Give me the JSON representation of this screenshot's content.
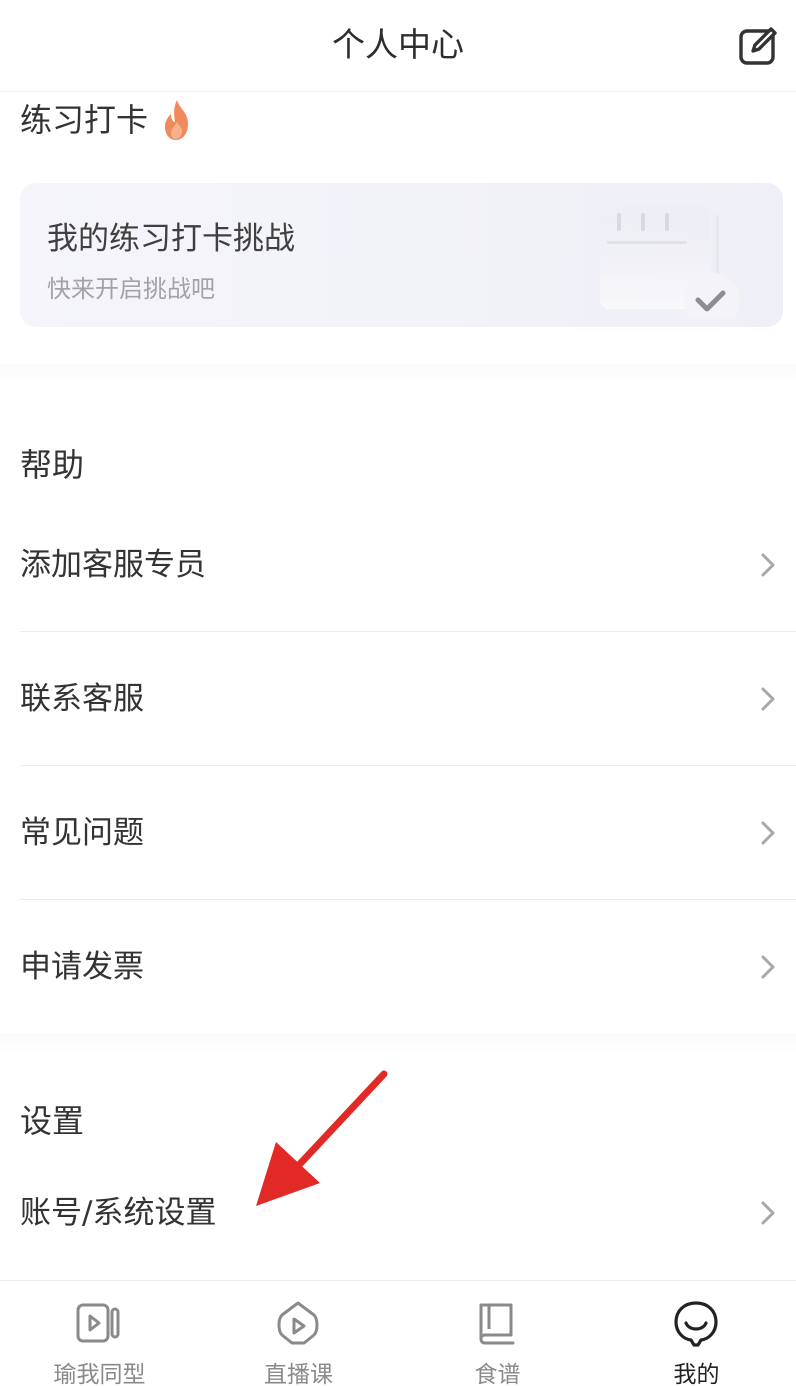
{
  "header": {
    "title": "个人中心",
    "edit_icon": "edit-icon"
  },
  "checkin": {
    "title": "练习打卡",
    "title_icon": "fire-icon",
    "card_title": "我的练习打卡挑战",
    "card_subtitle": "快来开启挑战吧",
    "card_icon": "calendar-check-icon"
  },
  "help": {
    "title": "帮助",
    "items": [
      {
        "label": "添加客服专员"
      },
      {
        "label": "联系客服"
      },
      {
        "label": "常见问题"
      },
      {
        "label": "申请发票"
      }
    ]
  },
  "settings": {
    "title": "设置",
    "items": [
      {
        "label": "账号/系统设置"
      }
    ]
  },
  "tabbar": {
    "items": [
      {
        "label": "瑜我同型",
        "icon": "video-icon",
        "active": false
      },
      {
        "label": "直播课",
        "icon": "live-play-icon",
        "active": false
      },
      {
        "label": "食谱",
        "icon": "book-icon",
        "active": false
      },
      {
        "label": "我的",
        "icon": "face-icon",
        "active": true
      }
    ]
  },
  "colors": {
    "accent_arrow": "#e12a25",
    "fire": "#f08a5d",
    "text": "#333333",
    "muted": "#a2a2a8"
  }
}
